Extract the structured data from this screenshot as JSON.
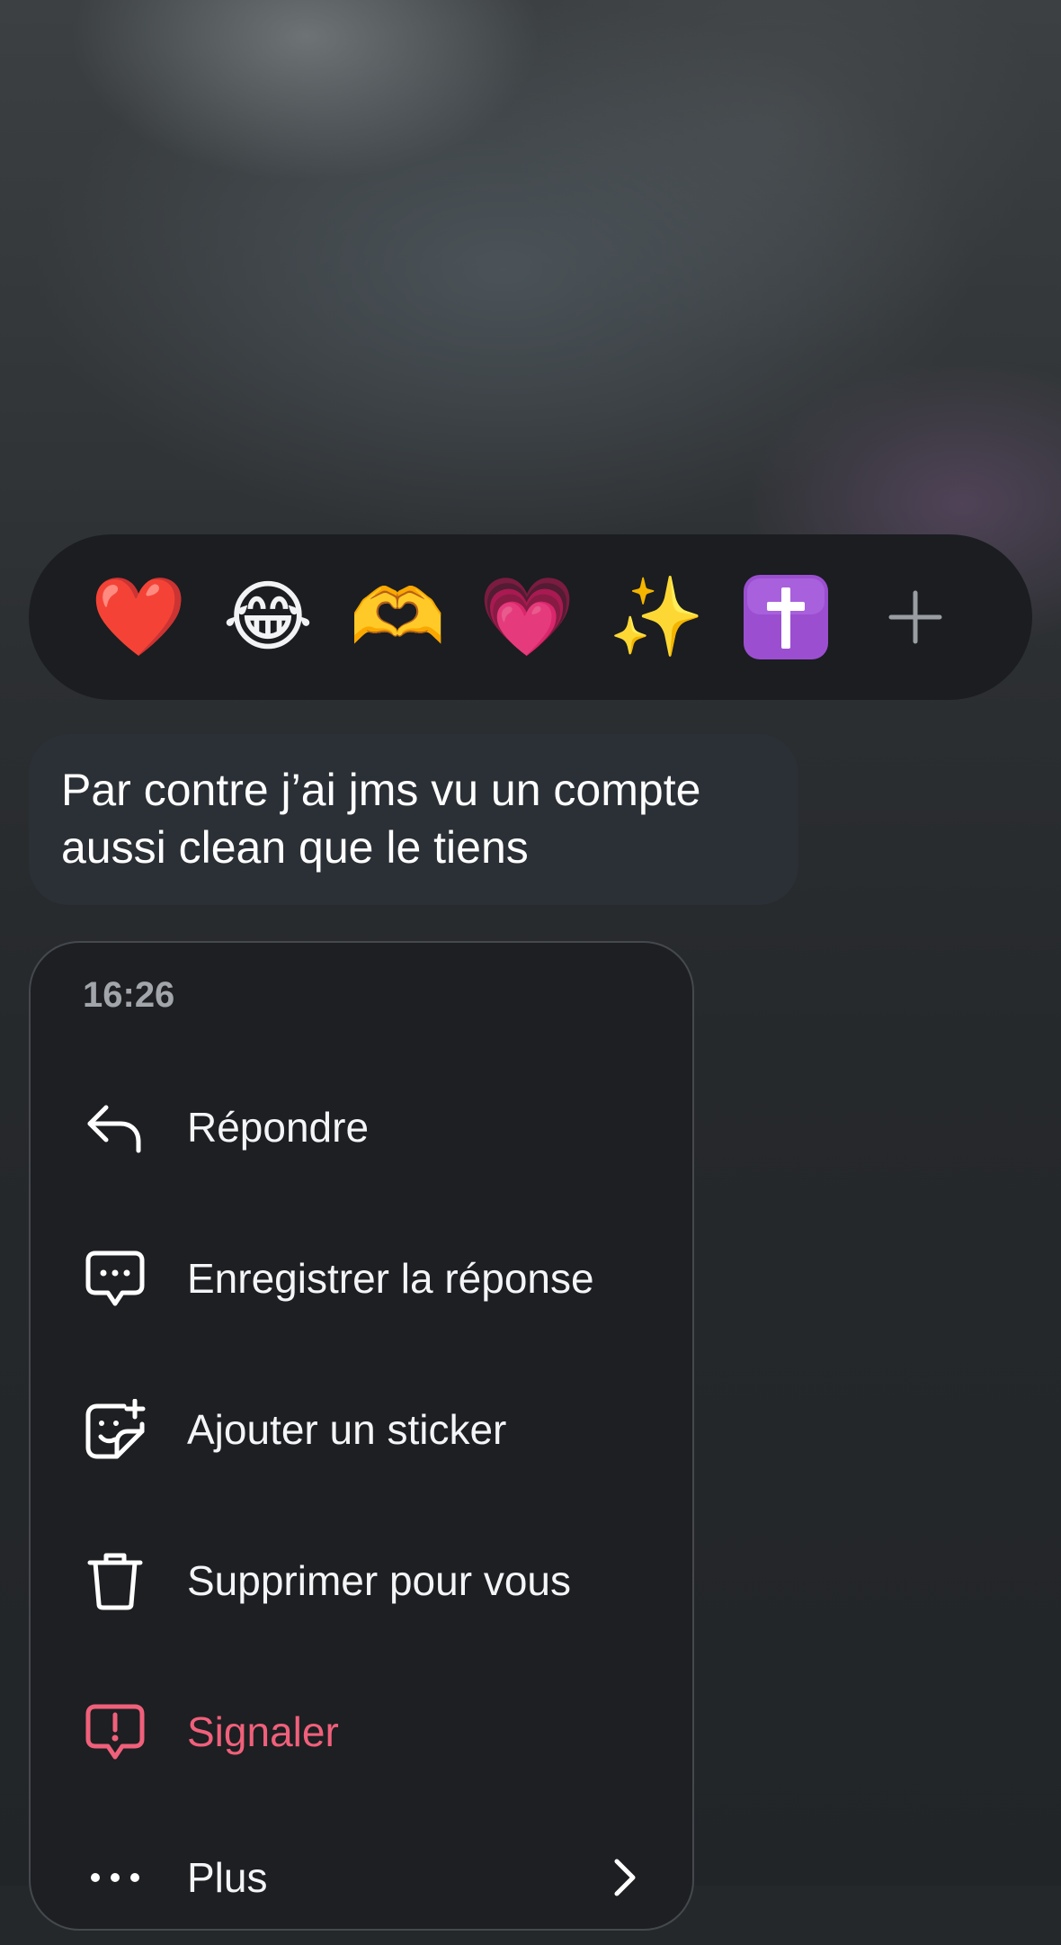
{
  "reactions": {
    "emojis": [
      {
        "glyph": "❤️",
        "icon": "red-heart-icon"
      },
      {
        "glyph": "😂",
        "icon": "tears-of-joy-icon"
      },
      {
        "glyph": "🫶",
        "icon": "heart-hands-icon"
      },
      {
        "glyph": "💗",
        "icon": "growing-heart-icon"
      },
      {
        "glyph": "✨",
        "icon": "sparkles-icon"
      },
      {
        "glyph": "✝",
        "icon": "latin-cross-icon"
      }
    ],
    "more_icon": "plus-icon"
  },
  "message": {
    "text": "Par contre j’ai jms vu un compte aussi clean que le tiens"
  },
  "menu": {
    "time": "16:26",
    "items": [
      {
        "label": "Répondre",
        "icon": "reply-arrow-icon"
      },
      {
        "label": "Enregistrer la réponse",
        "icon": "saved-reply-icon"
      },
      {
        "label": "Ajouter un sticker",
        "icon": "sticker-add-icon"
      },
      {
        "label": "Supprimer pour vous",
        "icon": "trash-icon"
      },
      {
        "label": "Signaler",
        "icon": "report-icon"
      },
      {
        "label": "Plus",
        "icon": "more-dots-icon"
      }
    ]
  },
  "colors": {
    "background": "#25282b",
    "reaction_bar": "#1b1d20",
    "bubble": "#2b3036",
    "menu": "#1d1f22",
    "danger": "#f0607b",
    "cross_tile": "#9b4fd0"
  }
}
